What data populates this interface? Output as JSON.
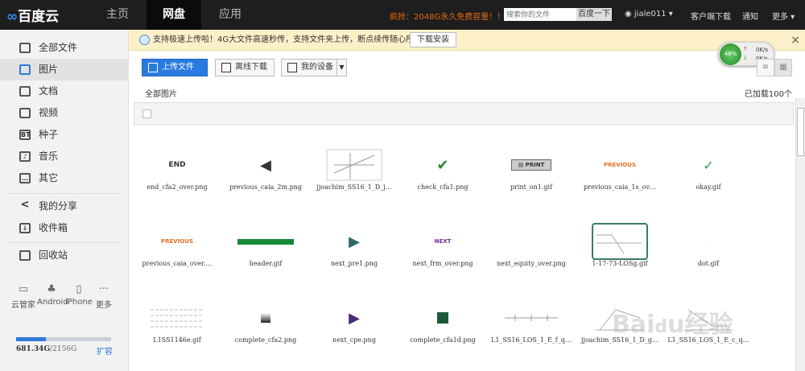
{
  "header": {
    "logo": "百度云",
    "nav": [
      "主页",
      "网盘",
      "应用"
    ],
    "nav_active": 1,
    "promo": "疯抢：2048G永久免费容量！！",
    "search_placeholder": "搜索你的文件",
    "search_button": "百度一下",
    "user": "jiale011",
    "links": [
      "客户端下载",
      "通知",
      "更多"
    ]
  },
  "sidebar": {
    "items": [
      {
        "label": "全部文件",
        "icon": "folder-icon"
      },
      {
        "label": "图片",
        "icon": "image-icon",
        "active": true
      },
      {
        "label": "文档",
        "icon": "document-icon"
      },
      {
        "label": "视频",
        "icon": "video-icon"
      },
      {
        "label": "种子",
        "icon": "torrent-icon"
      },
      {
        "label": "音乐",
        "icon": "music-icon"
      },
      {
        "label": "其它",
        "icon": "other-icon"
      }
    ],
    "items2": [
      {
        "label": "我的分享",
        "icon": "share-icon"
      },
      {
        "label": "收件箱",
        "icon": "inbox-icon"
      }
    ],
    "trash": "回收站",
    "devices": [
      "云管家",
      "Android",
      "iPhone",
      "更多"
    ],
    "quota_used": "681.34G",
    "quota_total": "/2156G",
    "quota_fraction": 0.316,
    "expand": "扩容"
  },
  "notice": {
    "text": "支持极速上传啦！4G大文件高速秒传，支持文件夹上传，断点续传随心所欲！",
    "button": "下载安装"
  },
  "toolbar": {
    "upload": "上传文件",
    "offline": "离线下载",
    "device": "我的设备"
  },
  "speed": {
    "percent": "48%",
    "up": "0K/s",
    "down": "0K/s"
  },
  "crumb": "全部图片",
  "count": "已加载100个",
  "files": [
    "end_cfa2_over.png",
    "previous_caia_2m.png",
    "jjoachim_SS16_1_D_j…",
    "check_cfa1.png",
    "print_on1.gif",
    "previous_caia_1s_ov…",
    "okay.gif",
    "previous_caia_over.…",
    "header.gif",
    "next_pre1.png",
    "next_frm_over.png",
    "next_equity_over.png",
    "1-17-73-LOSg.gif",
    "dot.gif",
    "L1SS1146e.gif",
    "complete_cfa2.png",
    "next_cpe.png",
    "complete_cfa1d.png",
    "L1_SS16_LOS_1_E_f_q…",
    "jjoachim_SS16_1_D_g…",
    "L1_SS16_LOS_1_E_c_q…"
  ],
  "watermark": "Baidu经验"
}
